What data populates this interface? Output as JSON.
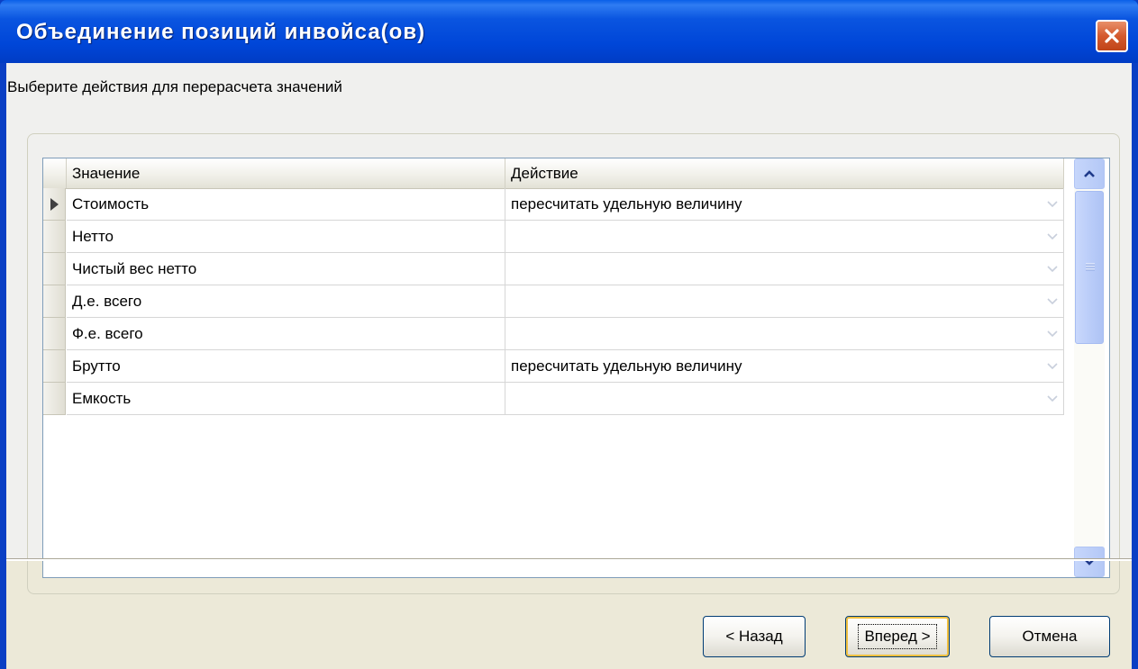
{
  "window": {
    "title": "Объединение позиций инвойса(ов)"
  },
  "instruction": "Выберите действия для перерасчета значений",
  "grid": {
    "columns": [
      "Значение",
      "Действие"
    ],
    "rows": [
      {
        "value": "Стоимость",
        "action": "пересчитать удельную величину",
        "current": true
      },
      {
        "value": "Нетто",
        "action": ""
      },
      {
        "value": "Чистый вес нетто",
        "action": ""
      },
      {
        "value": "Д.е. всего",
        "action": ""
      },
      {
        "value": "Ф.е. всего",
        "action": ""
      },
      {
        "value": "Брутто",
        "action": "пересчитать удельную величину"
      },
      {
        "value": "Емкость",
        "action": ""
      }
    ]
  },
  "buttons": {
    "back": "< Назад",
    "next": "Вперед >",
    "cancel": "Отмена"
  },
  "colors": {
    "titlebar": "#0054e3",
    "close": "#d45a2e",
    "dialog_bg": "#ece9d8"
  }
}
